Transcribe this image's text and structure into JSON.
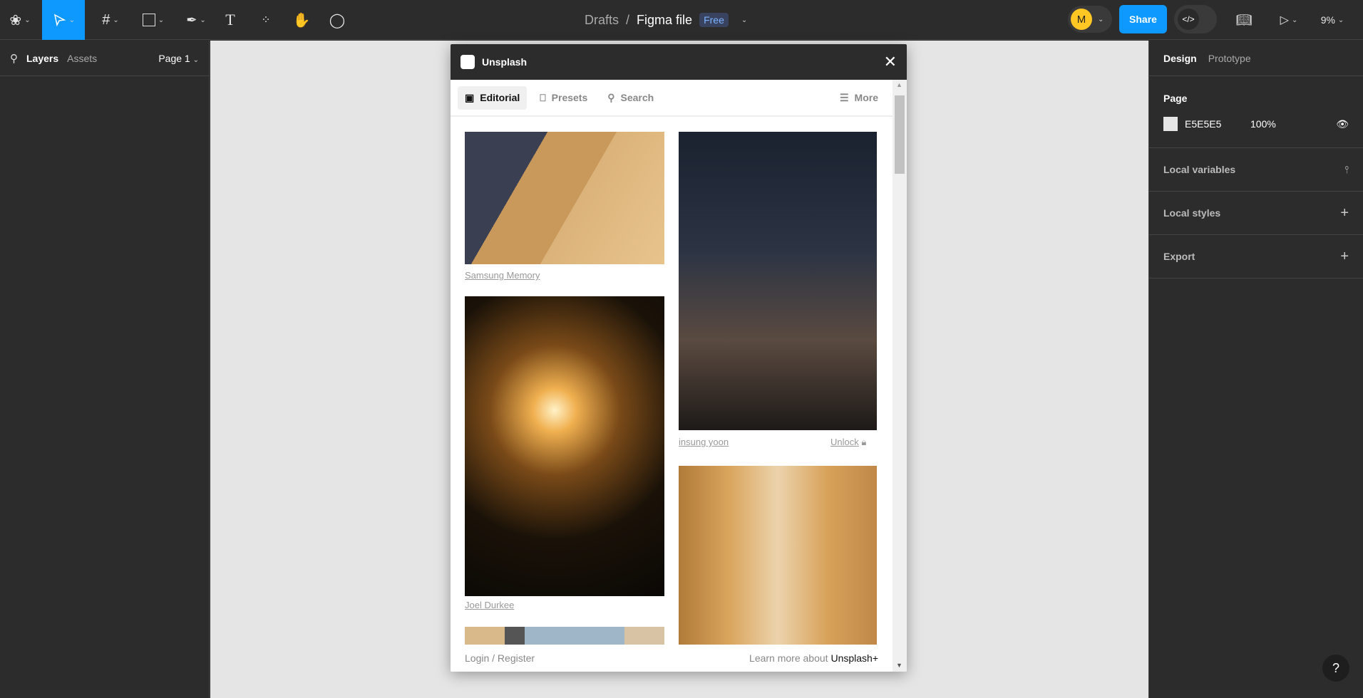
{
  "toolbar": {
    "breadcrumb": "Drafts",
    "separator": "/",
    "file_name": "Figma file",
    "plan_badge": "Free",
    "avatar_initial": "M",
    "share_label": "Share",
    "zoom": "9%"
  },
  "left_panel": {
    "tab_layers": "Layers",
    "tab_assets": "Assets",
    "page": "Page 1"
  },
  "right_panel": {
    "tab_design": "Design",
    "tab_prototype": "Prototype",
    "page_heading": "Page",
    "page_color": "E5E5E5",
    "page_opacity": "100%",
    "local_variables": "Local variables",
    "local_styles": "Local styles",
    "export": "Export"
  },
  "plugin": {
    "title": "Unsplash",
    "tabs": [
      {
        "label": "Editorial"
      },
      {
        "label": "Presets"
      },
      {
        "label": "Search"
      }
    ],
    "more": "More",
    "photos": [
      {
        "author": "Samsung Memory"
      },
      {
        "author": "Joel Durkee"
      },
      {
        "author": "insung yoon",
        "unlock": "Unlock"
      }
    ],
    "footer_login": "Login / Register",
    "footer_learn": "Learn more about",
    "footer_brand": "Unsplash+"
  },
  "colors": {
    "accent": "#0d99ff",
    "canvas": "#E5E5E5",
    "avatar": "#ffc724"
  }
}
